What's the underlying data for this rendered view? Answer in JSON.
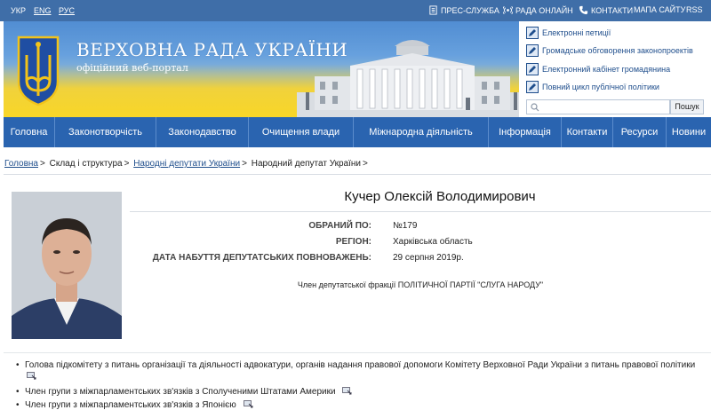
{
  "top_bar": {
    "languages": [
      "УКР",
      "ENG",
      "РУС"
    ],
    "links": [
      "ПРЕС-СЛУЖБА",
      "РАДА ОНЛАЙН",
      "КОНТАКТИ",
      "МАПА САЙТУ",
      "RSS"
    ]
  },
  "header": {
    "title": "ВЕРХОВНА РАДА УКРАЇНИ",
    "subtitle": "офіційний веб-портал"
  },
  "quick_links": [
    "Електронні петиції",
    "Громадське обговорення законопроектів",
    "Електронний кабінет громадянина",
    "Повний цикл публічної політики"
  ],
  "search": {
    "button": "Пошук",
    "placeholder": ""
  },
  "nav": [
    "Головна",
    "Законотворчість",
    "Законодавство",
    "Очищення влади",
    "Міжнародна діяльність",
    "Інформація",
    "Контакти",
    "Ресурси",
    "Новини"
  ],
  "breadcrumb": [
    "Головна",
    "Склад і структура",
    "Народні депутати України",
    "Народний депутат України"
  ],
  "deputy": {
    "name": "Кучер Олексій Володимирович",
    "fields": [
      {
        "label": "ОБРАНИЙ ПО:",
        "value": "№179"
      },
      {
        "label": "РЕГІОН:",
        "value": "Харківська область"
      },
      {
        "label": "ДАТА НАБУТТЯ ДЕПУТАТСЬКИХ ПОВНОВАЖЕНЬ:",
        "value": "29 серпня 2019р."
      }
    ],
    "faction": "Член депутатської фракції ПОЛІТИЧНОЇ ПАРТІЇ \"СЛУГА НАРОДУ\""
  },
  "posts": [
    "Голова підкомітету з питань організації та діяльності адвокатури, органів надання правової допомоги Комітету Верховної Ради України з питань правової політики",
    "Член групи з міжпарламентських зв'язків з Сполученими Штатами Америки",
    "Член групи з міжпарламентських зв'язків з Японією"
  ],
  "colors": {
    "top_bar": "#3f6ea8",
    "nav": "#2a64b0",
    "link": "#1f4e8c",
    "flag_blue": "#5d9bd8",
    "flag_yellow": "#f6d528"
  },
  "icons": [
    "printer-icon",
    "broadcast-icon",
    "phone-icon",
    "pen-icon",
    "search-icon",
    "external-link-icon"
  ]
}
